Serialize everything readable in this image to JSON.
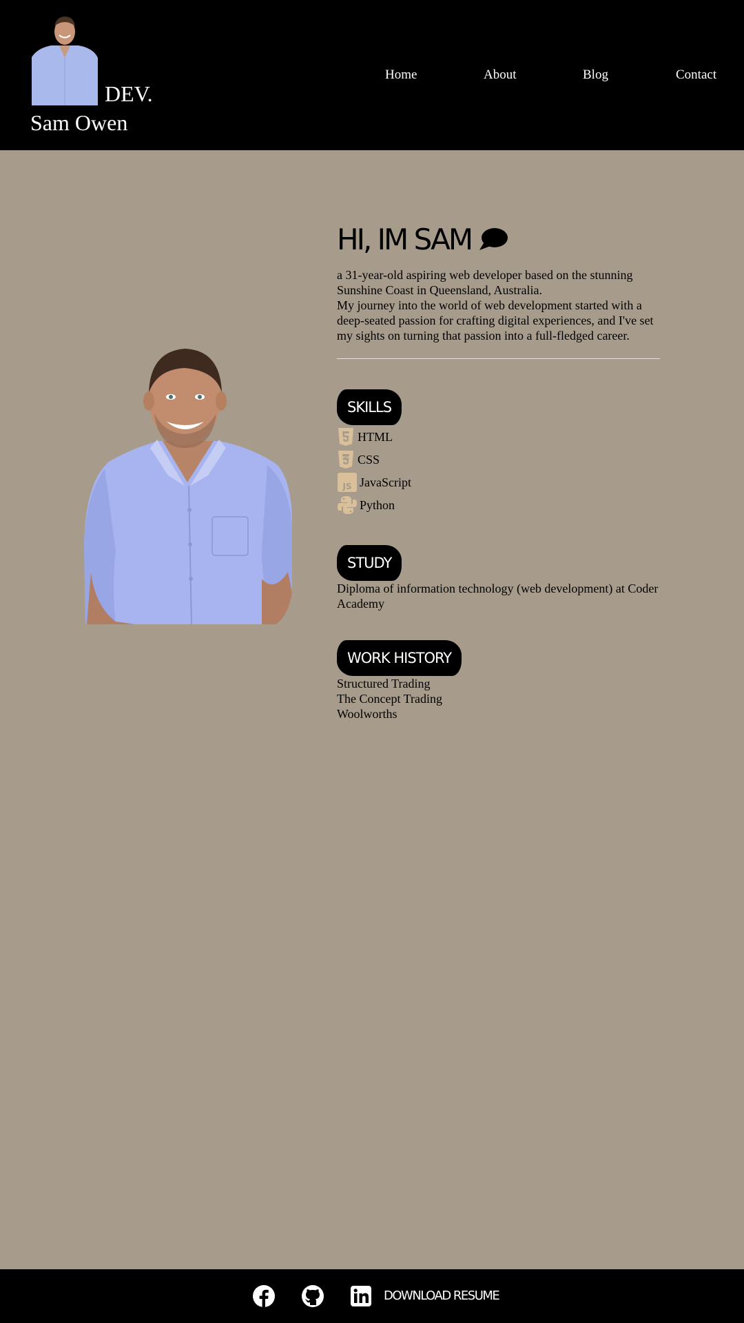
{
  "header": {
    "logo_suffix": "DEV.",
    "name": "Sam Owen",
    "nav": [
      "Home",
      "About",
      "Blog",
      "Contact"
    ]
  },
  "intro": {
    "heading": "HI, IM SAM",
    "bio_line1": "a 31-year-old aspiring web developer based on the stunning Sunshine Coast in Queensland, Australia.",
    "bio_line2": "My journey into the world of web development started with a deep-seated passion for crafting digital experiences, and I've set my sights on turning that passion into a full-fledged career."
  },
  "skills": {
    "title": "SKILLS",
    "items": [
      {
        "label": "HTML",
        "icon": "html5-icon"
      },
      {
        "label": "CSS",
        "icon": "css3-icon"
      },
      {
        "label": "JavaScript",
        "icon": "javascript-icon"
      },
      {
        "label": "Python",
        "icon": "python-icon"
      }
    ]
  },
  "study": {
    "title": "STUDY",
    "text": "Diploma of information technology (web development) at Coder Academy"
  },
  "work": {
    "title": "WORK HISTORY",
    "items": [
      "Structured Trading",
      "The Concept Trading",
      "Woolworths"
    ]
  },
  "footer": {
    "download_label": "DOWNLOAD RESUME",
    "icons": [
      "facebook-icon",
      "github-icon",
      "linkedin-icon"
    ]
  },
  "colors": {
    "background": "#a79c8c",
    "header": "#000000",
    "icon_tan": "#d9c09a"
  }
}
